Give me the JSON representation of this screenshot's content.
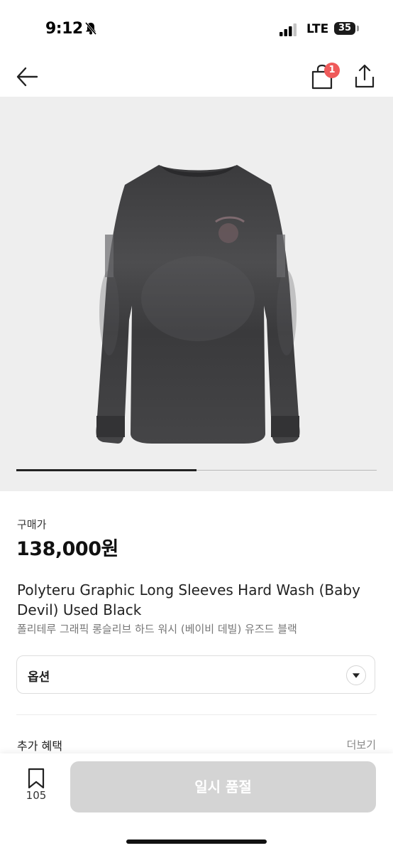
{
  "status_bar": {
    "time": "9:12",
    "network": "LTE",
    "battery": "35",
    "icons": [
      "bell-slash-icon",
      "signal-icon",
      "battery-icon"
    ]
  },
  "nav": {
    "icons": [
      "back-arrow-icon",
      "shopping-bag-icon",
      "share-icon"
    ],
    "bag_badge": "1"
  },
  "gallery": {
    "image": "charcoal washed long sleeve graphic tee",
    "progress": 0.5
  },
  "product": {
    "price_label": "구매가",
    "price": "138,000원",
    "name_en": "Polyteru Graphic Long Sleeves Hard Wash (Baby Devil) Used Black",
    "name_ko": "폴리테루 그래픽 롱슬리브 하드 워시 (베이비 데빌) 유즈드 블랙"
  },
  "option": {
    "label": "옵션",
    "icon": "chevron-down-icon"
  },
  "benefits": {
    "label": "추가 혜택",
    "more": "더보기"
  },
  "bottom_bar": {
    "bookmark_icon": "bookmark-icon",
    "bookmark_count": "105",
    "buy_button": "일시 품절"
  },
  "colors": {
    "badge": "#ef5a5a",
    "disabled_button": "#d4d4d4",
    "gallery_bg": "#eeeeee"
  }
}
